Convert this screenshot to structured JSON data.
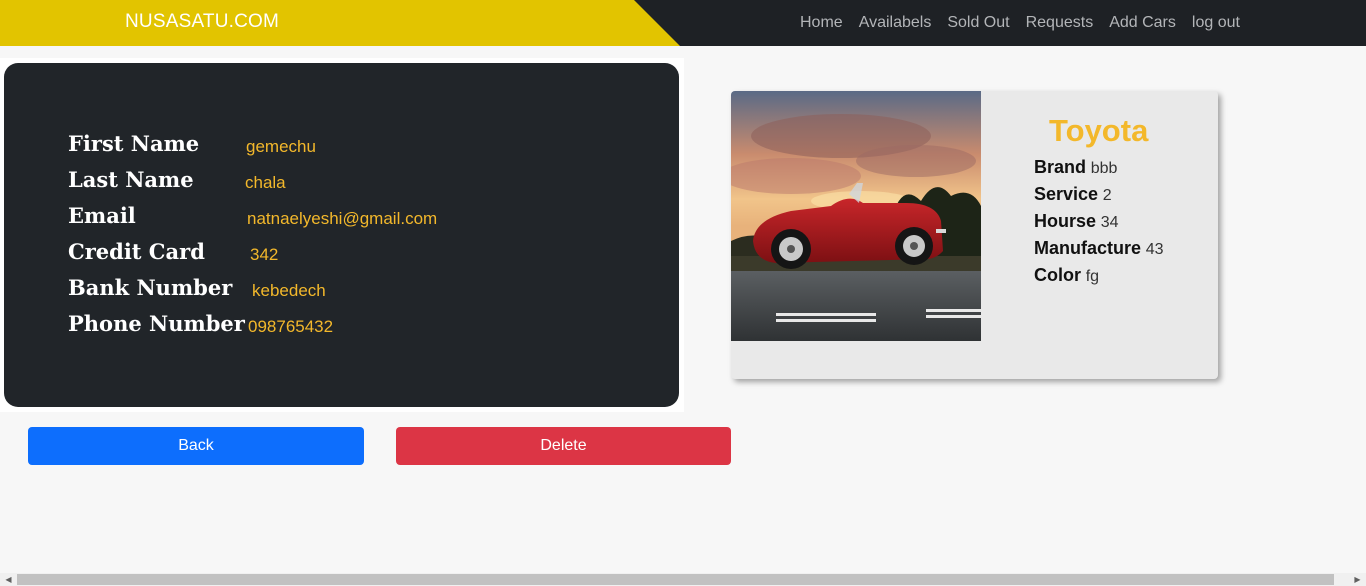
{
  "navbar": {
    "brand": "NUSASATU.COM",
    "links": [
      "Home",
      "Availabels",
      "Sold Out",
      "Requests",
      "Add Cars",
      "log out"
    ]
  },
  "user": {
    "fields": [
      {
        "label": "First Name",
        "value": "gemechu"
      },
      {
        "label": "Last Name",
        "value": "chala"
      },
      {
        "label": "Email",
        "value": "natnaelyeshi@gmail.com"
      },
      {
        "label": "Credit Card",
        "value": "342"
      },
      {
        "label": "Bank Number",
        "value": "kebedech"
      },
      {
        "label": "Phone Number",
        "value": "098765432"
      }
    ]
  },
  "buttons": {
    "back": "Back",
    "delete": "Delete"
  },
  "car": {
    "title": "Toyota",
    "details": [
      {
        "key": "Brand",
        "value": "bbb"
      },
      {
        "key": "Service",
        "value": "2"
      },
      {
        "key": "Hourse",
        "value": "34"
      },
      {
        "key": "Manufacture",
        "value": "43"
      },
      {
        "key": "Color",
        "value": "fg"
      }
    ]
  },
  "colors": {
    "navbar": "#1e2125",
    "brand_bg": "#e2c400",
    "accent_text": "#f3b82b",
    "back_button": "#0d6efd",
    "delete_button": "#dc3545"
  }
}
